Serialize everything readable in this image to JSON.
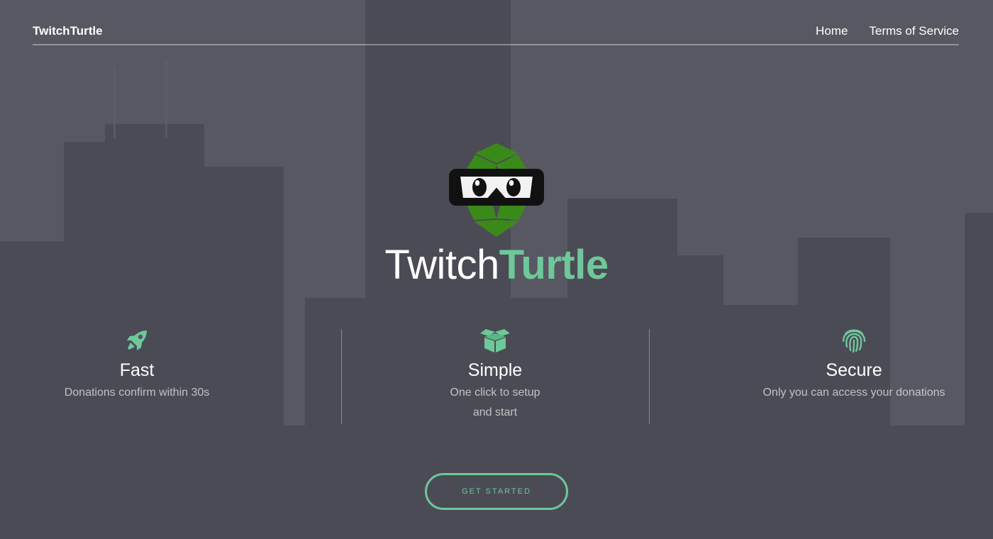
{
  "navbar": {
    "brand": "TwitchTurtle",
    "links": [
      {
        "label": "Home"
      },
      {
        "label": "Terms of Service"
      }
    ]
  },
  "hero": {
    "title_part1": "Twitch",
    "title_part2": "Turtle",
    "logo_icon": "turtle-mask-logo"
  },
  "features": [
    {
      "icon": "rocket-icon",
      "title": "Fast",
      "description_lines": [
        "Donations confirm within 30s"
      ]
    },
    {
      "icon": "box-icon",
      "title": "Simple",
      "description_lines": [
        "One click to setup",
        "and start"
      ]
    },
    {
      "icon": "fingerprint-icon",
      "title": "Secure",
      "description_lines": [
        "Only you can access your donations"
      ]
    }
  ],
  "cta": {
    "label": "GET STARTED"
  },
  "colors": {
    "accent": "#6ec89a",
    "logo_green": "#3a8a1a",
    "overlay": "#55555f"
  }
}
